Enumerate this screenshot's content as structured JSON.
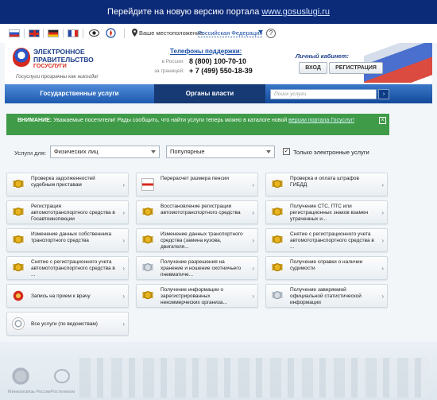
{
  "top_banner": {
    "text": "Перейдите на новую версию портала",
    "link": "www.gosuslugi.ru"
  },
  "location": {
    "label": "Ваше местоположение:",
    "value": "Российская Федерация"
  },
  "logo": {
    "line1": "ЭЛЕКТРОННОЕ",
    "line2": "ПРАВИТЕЛЬСТВО",
    "line3": "ГОСУСЛУГИ",
    "tagline": "Госуслуги прозрачны как никогда!"
  },
  "support": {
    "title": "Телефоны поддержки:",
    "rows": [
      {
        "label": "в России:",
        "number": "8 (800) 100-70-10"
      },
      {
        "label": "за границей:",
        "number": "+ 7 (499) 550-18-39"
      }
    ]
  },
  "cabinet": {
    "title": "Личный кабинет:",
    "login": "ВХОД",
    "register": "РЕГИСТРАЦИЯ"
  },
  "nav": {
    "tab1": "Государственные услуги",
    "tab2": "Органы власти",
    "search_placeholder": "Поиск услуги"
  },
  "notice": {
    "prefix": "ВНИМАНИЕ:",
    "text": "Уважаемые посетители! Рады сообщить, что найти услуги теперь можно в каталоге новой",
    "link": "версии портала Госуслуг!"
  },
  "filters": {
    "label": "Услуги для:",
    "audience": "Физических лиц",
    "sort": "Популярные",
    "only_electronic": "Только электронные услуги",
    "only_electronic_checked": true
  },
  "services": [
    [
      "Проверка задолженностей судебным приставам",
      "Перерасчет размера пенсии",
      "Проверка и оплата штрафов ГИБДД"
    ],
    [
      "Регистрация автомототранспортного средства в Госавтоинспекции",
      "Восстановление регистрации автомототранспортного средства",
      "Получение СТС, ПТС или регистрационных знаков взамен утраченных и..."
    ],
    [
      "Изменение данных собственника транспортного средства",
      "Изменение данных транспортного средства (замена кузова, двигателя...",
      "Снятие с регистрационного учета автомототранспортного средства в ..."
    ],
    [
      "Снятие с регистрационного учета автомототранспортного средства в ...",
      "Получение разрешения на хранение и ношение охотничьего пневматиче...",
      "Получение справки о наличии судимости"
    ],
    [
      "Запись на прием к врачу",
      "Получение информации о зарегистрированных некоммерческих организа...",
      "Получение заверяемой официальной статистической информации"
    ],
    [
      "Все услуги (по ведомствам)"
    ]
  ],
  "footer": {
    "emblem_caption": "Минкомсвязь России",
    "partner": "Ростелеком"
  },
  "colors": {
    "banner": "#0b2a78",
    "nav": "#1d5ab0",
    "notice": "#3f9b48"
  }
}
